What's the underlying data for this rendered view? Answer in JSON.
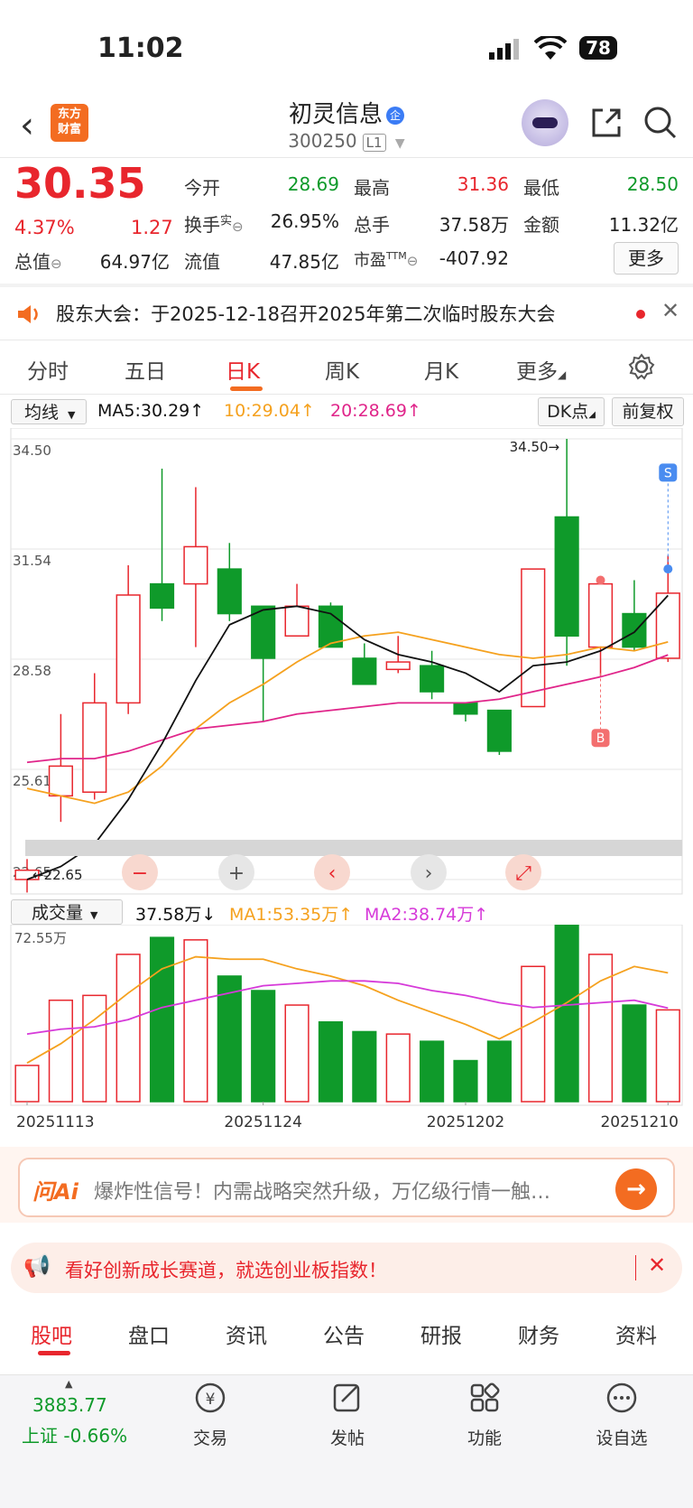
{
  "status_bar": {
    "time": "11:02",
    "battery": "78"
  },
  "header": {
    "logo_line1": "东方",
    "logo_line2": "财富",
    "stock_name": "初灵信息",
    "name_badge": "企",
    "stock_code": "300250",
    "code_tag": "L1"
  },
  "quote": {
    "price": "30.35",
    "change_pct": "4.37%",
    "change": "1.27",
    "rows": [
      [
        {
          "label": "今开",
          "value": "28.69",
          "color": "green"
        },
        {
          "label": "最高",
          "value": "31.36",
          "color": "red"
        },
        {
          "label": "最低",
          "value": "28.50",
          "color": "green"
        }
      ],
      [
        {
          "label": "换手",
          "value": "26.95%",
          "color": "black",
          "sup": "实"
        },
        {
          "label": "总手",
          "value": "37.58万",
          "color": "black"
        },
        {
          "label": "金额",
          "value": "11.32亿",
          "color": "black"
        }
      ],
      [
        {
          "label": "总值",
          "value": "64.97亿",
          "color": "black"
        },
        {
          "label": "流值",
          "value": "47.85亿",
          "color": "black"
        },
        {
          "label": "市盈",
          "value": "-407.92",
          "color": "black",
          "sup": "TTM"
        }
      ]
    ],
    "more_label": "更多"
  },
  "notice": {
    "text": "股东大会：于2025-12-18召开2025年第二次临时股东大会"
  },
  "chart_tabs": [
    "分时",
    "五日",
    "日K",
    "周K",
    "月K",
    "更多"
  ],
  "active_chart_tab": "日K",
  "ma_bar": {
    "select": "均线",
    "ma5": "MA5:30.29↑",
    "ma10": "10:29.04↑",
    "ma20": "20:28.69↑",
    "dk": "DK点",
    "fq": "前复权"
  },
  "vol_bar": {
    "select": "成交量",
    "vol": "37.58万↓",
    "ma1": "MA1:53.35万↑",
    "ma2": "MA2:38.74万↑"
  },
  "chart_data": {
    "type": "candlestick",
    "y_ticks": [
      "34.50",
      "31.54",
      "28.58",
      "25.61",
      "22.65"
    ],
    "ylim": [
      22.65,
      34.5
    ],
    "max_label": "34.50→",
    "min_label": "←22.65",
    "x_labels": [
      "20251113",
      "20251124",
      "20251202",
      "20251210"
    ],
    "signal_s": "S",
    "signal_b": "B",
    "candles": [
      {
        "o": 22.65,
        "c": 22.9,
        "h": 23.2,
        "l": 22.3,
        "dir": "up"
      },
      {
        "o": 24.9,
        "c": 25.7,
        "h": 27.1,
        "l": 24.2,
        "dir": "up"
      },
      {
        "o": 25.0,
        "c": 27.4,
        "h": 28.2,
        "l": 24.8,
        "dir": "up"
      },
      {
        "o": 27.4,
        "c": 30.3,
        "h": 31.1,
        "l": 27.1,
        "dir": "up"
      },
      {
        "o": 30.6,
        "c": 29.95,
        "h": 33.7,
        "l": 29.6,
        "dir": "down"
      },
      {
        "o": 30.6,
        "c": 31.6,
        "h": 33.2,
        "l": 28.9,
        "dir": "up"
      },
      {
        "o": 31.0,
        "c": 29.8,
        "h": 31.7,
        "l": 29.6,
        "dir": "down"
      },
      {
        "o": 30.0,
        "c": 28.6,
        "h": 30.0,
        "l": 26.9,
        "dir": "down"
      },
      {
        "o": 29.2,
        "c": 30.0,
        "h": 30.6,
        "l": 29.2,
        "dir": "up"
      },
      {
        "o": 30.0,
        "c": 28.9,
        "h": 30.1,
        "l": 28.9,
        "dir": "down"
      },
      {
        "o": 28.6,
        "c": 27.9,
        "h": 29.0,
        "l": 27.9,
        "dir": "down"
      },
      {
        "o": 28.3,
        "c": 28.5,
        "h": 29.2,
        "l": 28.2,
        "dir": "up"
      },
      {
        "o": 28.4,
        "c": 27.7,
        "h": 28.8,
        "l": 27.5,
        "dir": "down"
      },
      {
        "o": 27.4,
        "c": 27.1,
        "h": 27.4,
        "l": 26.9,
        "dir": "down"
      },
      {
        "o": 27.2,
        "c": 26.1,
        "h": 27.2,
        "l": 26.0,
        "dir": "down"
      },
      {
        "o": 27.3,
        "c": 31.0,
        "h": 31.0,
        "l": 27.3,
        "dir": "up"
      },
      {
        "o": 32.4,
        "c": 29.2,
        "h": 34.5,
        "l": 28.4,
        "dir": "down"
      },
      {
        "o": 28.9,
        "c": 30.6,
        "h": 30.8,
        "l": 28.1,
        "dir": "up"
      },
      {
        "o": 29.8,
        "c": 28.9,
        "h": 30.7,
        "l": 28.8,
        "dir": "down"
      },
      {
        "o": 28.6,
        "c": 30.35,
        "h": 31.36,
        "l": 28.5,
        "dir": "up"
      }
    ],
    "ma5": [
      22.65,
      23.0,
      23.6,
      24.8,
      26.3,
      28.0,
      29.5,
      29.9,
      30.0,
      29.8,
      29.1,
      28.7,
      28.5,
      28.2,
      27.7,
      28.4,
      28.5,
      28.8,
      29.3,
      30.29
    ],
    "ma10": [
      25.1,
      24.9,
      24.7,
      25.0,
      25.7,
      26.7,
      27.4,
      27.9,
      28.5,
      29.0,
      29.2,
      29.3,
      29.1,
      28.9,
      28.7,
      28.6,
      28.7,
      28.9,
      28.8,
      29.04
    ],
    "ma20": [
      25.8,
      25.9,
      25.9,
      26.1,
      26.4,
      26.7,
      26.8,
      26.9,
      27.1,
      27.2,
      27.3,
      27.4,
      27.4,
      27.4,
      27.5,
      27.7,
      27.9,
      28.1,
      28.35,
      28.69
    ],
    "volume": {
      "ylim": [
        0,
        72.55
      ],
      "top_label": "72.55万",
      "bars": [
        15,
        42,
        44,
        61,
        68,
        67,
        52,
        46,
        40,
        33,
        29,
        28,
        25,
        17,
        25,
        56,
        73,
        61,
        40,
        38
      ],
      "ma1": [
        16,
        24,
        34,
        45,
        55,
        60,
        59,
        59,
        55,
        52,
        48,
        42,
        37,
        32,
        26,
        33,
        41,
        50,
        56,
        53.35
      ],
      "ma2": [
        28,
        30,
        31,
        34,
        39,
        42,
        45,
        48,
        49,
        50,
        50,
        49,
        46,
        44,
        41,
        39,
        40,
        41,
        42,
        38.74
      ]
    }
  },
  "ai_bar": {
    "logo": "问Ai",
    "text": "爆炸性信号！内需战略突然升级，万亿级行情一触…"
  },
  "promo": {
    "text": "看好创新成长赛道，就选创业板指数！"
  },
  "bottom_tabs": [
    "股吧",
    "盘口",
    "资讯",
    "公告",
    "研报",
    "财务",
    "资料"
  ],
  "footer": {
    "index_value": "3883.77",
    "index_label": "上证 -0.66%",
    "items": [
      {
        "label": "交易",
        "icon": "trade-icon"
      },
      {
        "label": "发帖",
        "icon": "post-icon"
      },
      {
        "label": "功能",
        "icon": "function-icon"
      },
      {
        "label": "设自选",
        "icon": "add-favorite-icon"
      }
    ]
  },
  "colors": {
    "up": "#e8262d",
    "down": "#0f9a2a",
    "ma5": "#111111",
    "ma10": "#f5a11e",
    "ma20": "#e0258a",
    "accent": "#f36c21"
  }
}
